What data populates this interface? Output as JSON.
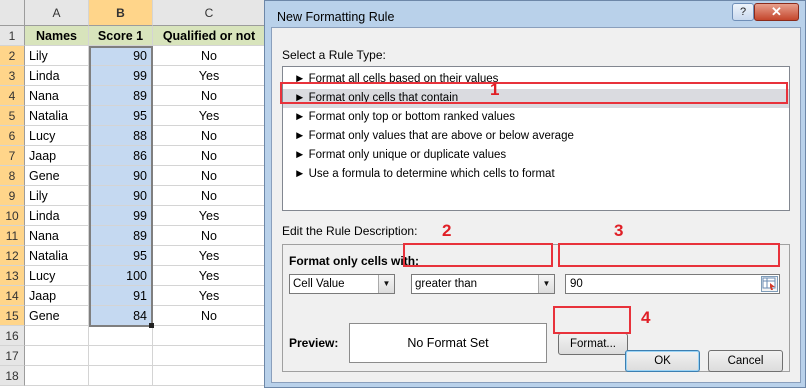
{
  "spreadsheet": {
    "columns": [
      "A",
      "B",
      "C"
    ],
    "headers": [
      "Names",
      "Score 1",
      "Qualified or not"
    ],
    "row_numbers": [
      "1",
      "2",
      "3",
      "4",
      "5",
      "6",
      "7",
      "8",
      "9",
      "10",
      "11",
      "12",
      "13",
      "14",
      "15",
      "16",
      "17",
      "18"
    ],
    "rows": [
      {
        "name": "Lily",
        "score": "90",
        "qualified": "No"
      },
      {
        "name": "Linda",
        "score": "99",
        "qualified": "Yes"
      },
      {
        "name": "Nana",
        "score": "89",
        "qualified": "No"
      },
      {
        "name": "Natalia",
        "score": "95",
        "qualified": "Yes"
      },
      {
        "name": "Lucy",
        "score": "88",
        "qualified": "No"
      },
      {
        "name": "Jaap",
        "score": "86",
        "qualified": "No"
      },
      {
        "name": "Gene",
        "score": "90",
        "qualified": "No"
      },
      {
        "name": "Lily",
        "score": "90",
        "qualified": "No"
      },
      {
        "name": "Linda",
        "score": "99",
        "qualified": "Yes"
      },
      {
        "name": "Nana",
        "score": "89",
        "qualified": "No"
      },
      {
        "name": "Natalia",
        "score": "95",
        "qualified": "Yes"
      },
      {
        "name": "Lucy",
        "score": "100",
        "qualified": "Yes"
      },
      {
        "name": "Jaap",
        "score": "91",
        "qualified": "Yes"
      },
      {
        "name": "Gene",
        "score": "84",
        "qualified": "No"
      }
    ]
  },
  "dialog": {
    "title": "New Formatting Rule",
    "help_label": "?",
    "close_label": "✕",
    "select_rule_type_label": "Select a Rule Type:",
    "rule_types": [
      "► Format all cells based on their values",
      "► Format only cells that contain",
      "► Format only top or bottom ranked values",
      "► Format only values that are above or below average",
      "► Format only unique or duplicate values",
      "► Use a formula to determine which cells to format"
    ],
    "selected_rule_index": 1,
    "edit_rule_description_label": "Edit the Rule Description:",
    "format_only_cells_with_label": "Format only cells with:",
    "condition_field": "Cell Value",
    "condition_operator": "greater than",
    "condition_value": "90",
    "preview_label": "Preview:",
    "preview_text": "No Format Set",
    "format_button": "Format...",
    "ok_button": "OK",
    "cancel_button": "Cancel"
  },
  "annotations": [
    "1",
    "2",
    "3",
    "4"
  ],
  "colors": {
    "header_fill": "#d8e4bc",
    "score_fill": "#c5d9f1",
    "annotation_red": "#e8323b",
    "dialog_frame": "#b9d1ea"
  }
}
